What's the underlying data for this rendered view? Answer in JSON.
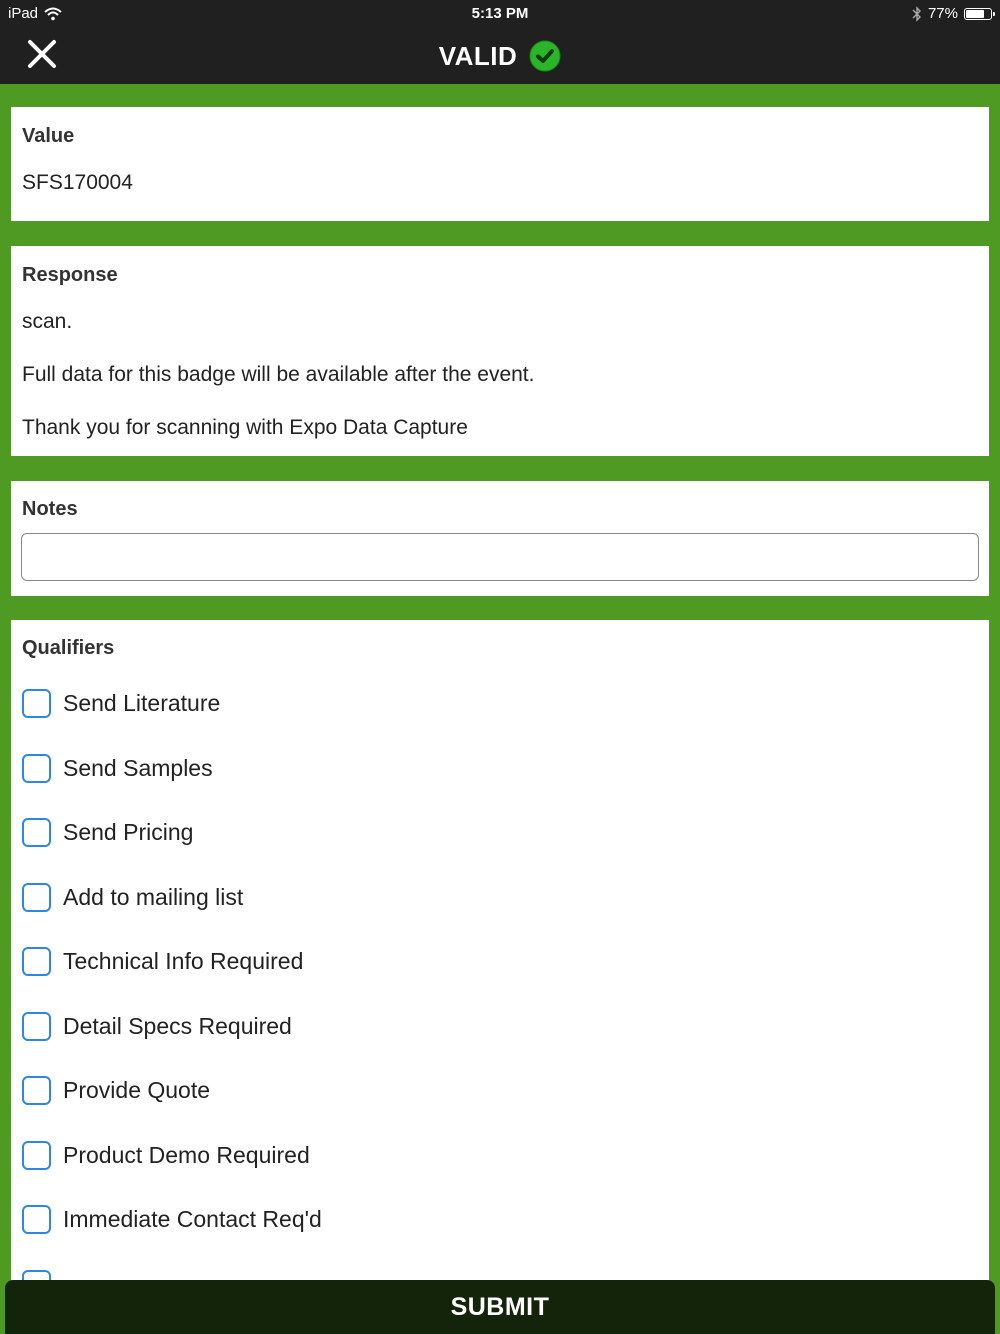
{
  "status": {
    "device": "iPad",
    "time": "5:13 PM",
    "battery": "77%",
    "battery_level": 0.77
  },
  "nav": {
    "title": "VALID",
    "close_icon": "close-icon",
    "valid_icon": "check-circle-icon"
  },
  "value_card": {
    "label": "Value",
    "value": "SFS170004"
  },
  "response_card": {
    "label": "Response",
    "lines": [
      "scan.",
      "Full data for this badge will be available after the event.",
      "Thank you for scanning with Expo Data Capture"
    ]
  },
  "notes_card": {
    "label": "Notes",
    "value": "",
    "placeholder": ""
  },
  "qualifiers_card": {
    "label": "Qualifiers",
    "items": [
      {
        "label": "Send Literature",
        "checked": false
      },
      {
        "label": "Send Samples",
        "checked": false
      },
      {
        "label": "Send Pricing",
        "checked": false
      },
      {
        "label": "Add to mailing list",
        "checked": false
      },
      {
        "label": "Technical Info Required",
        "checked": false
      },
      {
        "label": "Detail Specs Required",
        "checked": false
      },
      {
        "label": "Provide Quote",
        "checked": false
      },
      {
        "label": "Product Demo Required",
        "checked": false
      },
      {
        "label": "Immediate Contact Req'd",
        "checked": false
      }
    ]
  },
  "submit": {
    "label": "SUBMIT"
  },
  "colors": {
    "background_green": "#4e9a22",
    "navbar": "#202020",
    "checkbox_blue": "#2d87e5",
    "submit_bar": "#13240b"
  }
}
